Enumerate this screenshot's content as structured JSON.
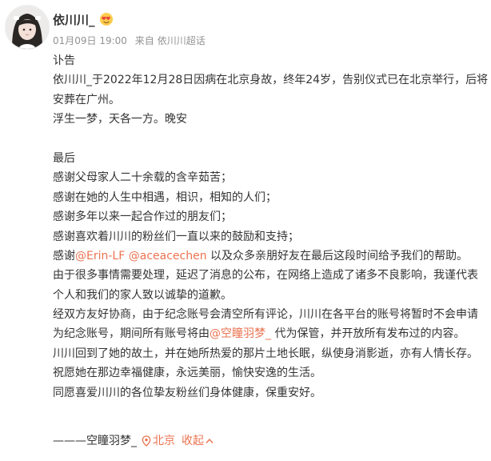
{
  "post": {
    "author": {
      "name": "依川川_",
      "avatar_icon": "avatar-photo",
      "badge_icon": "heart-emoji-icon"
    },
    "meta": {
      "time": "01月09日 19:00",
      "from_label": "来自",
      "source": "依川川超话"
    },
    "body": {
      "l1": "讣告",
      "l2": "依川川_于2022年12月28日因病在北京身故，终年24岁，告别仪式已在北京举行，后将",
      "l3": "安葬在广州。",
      "l4": "浮生一梦，天各一方。晚安",
      "l6": "最后",
      "l7": "感谢父母家人二十余载的含辛茹苦；",
      "l8": "感谢在她的人生中相遇，相识，相知的人们；",
      "l9": "感谢多年以来一起合作过的朋友们；",
      "l10": "感谢喜欢着川川的粉丝们一直以来的鼓励和支持；",
      "l11_prefix": "感谢",
      "l11_mention1": "@Erin-LF",
      "l11_space": " ",
      "l11_mention2": "@aceacechen",
      "l11_suffix": " 以及众多亲朋好友在最后这段时间给予我们的帮助。",
      "l12": "由于很多事情需要处理，延迟了消息的公布，在网络上造成了诸多不良影响，我谨代表",
      "l13": "个人和我们的家人致以诚挚的道歉。",
      "l14": "经双方友好协商，由于纪念账号会清空所有评论，川川在各平台的账号将暂时不会申请",
      "l15_prefix": "为纪念账号，期间所有账号将由",
      "l15_mention": "@空瞳羽梦_",
      "l15_suffix": " 代为保管，并开放所有发布过的内容。",
      "l16": "川川回到了她的故土，并在她所热爱的那片土地长眠，纵使身消影逝，亦有人情长存。",
      "l17": "祝愿她在那边幸福健康，永远美丽，愉快安逸的生活。",
      "l18": "同愿喜爱川川的各位挚友粉丝们身体健康，保重安好。",
      "signature": "———空瞳羽梦_",
      "location": "北京",
      "location_icon": "location-pin-icon",
      "collapse_label": "收起",
      "collapse_icon": "chevron-up-icon"
    },
    "colors": {
      "text": "#333333",
      "meta": "#939393",
      "link": "#eb7350"
    }
  }
}
